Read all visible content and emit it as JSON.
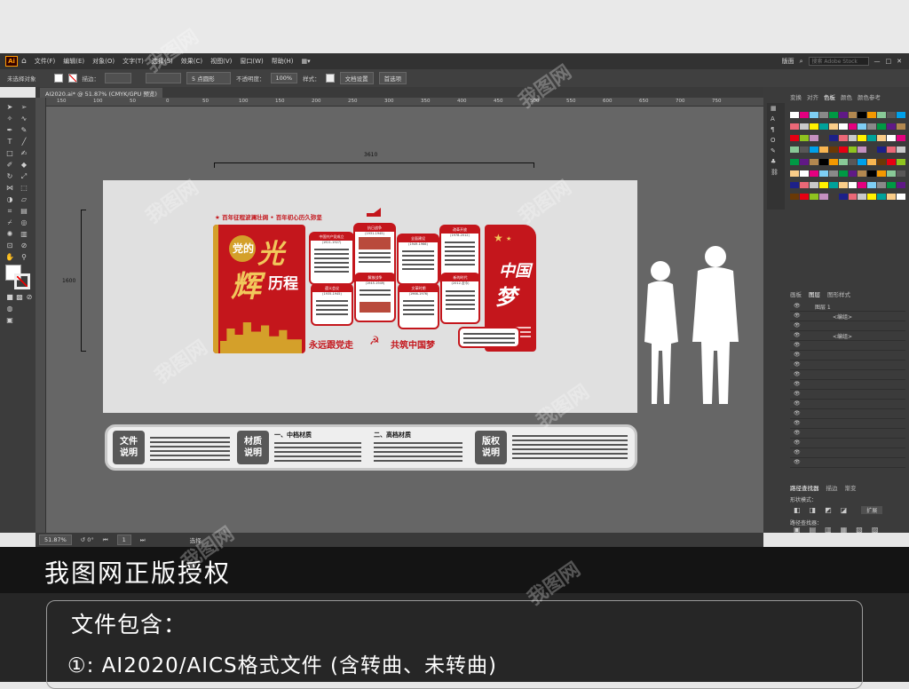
{
  "menu": {
    "app_icon": "Ai",
    "items": [
      "文件(F)",
      "编辑(E)",
      "对象(O)",
      "文字(T)",
      "选择(S)",
      "效果(C)",
      "视图(V)",
      "窗口(W)",
      "帮助(H)"
    ],
    "workspace": "版面",
    "search_placeholder": "搜索 Adobe Stock"
  },
  "control": {
    "selection": "未选择对象",
    "stroke_label": "描边：",
    "brush": "5 点圆形",
    "opacity_label": "不透明度：",
    "opacity": "100%",
    "style_label": "样式：",
    "doc_setup": "文档设置",
    "prefs": "首选项"
  },
  "document": {
    "tab": "AI2020.ai* @ 51.87% (CMYK/GPU 预览)"
  },
  "rulers": {
    "h_ticks": [
      "150",
      "100",
      "50",
      "0",
      "50",
      "100",
      "150",
      "200",
      "250",
      "300",
      "350",
      "400",
      "450",
      "500",
      "550",
      "600",
      "650",
      "700",
      "750"
    ],
    "width_dim": "3610",
    "height_dim": "1600"
  },
  "artboard": {
    "header": "★ 百年征程波澜壮阔 • 百年初心历久弥坚",
    "left_title": [
      "党的",
      "光",
      "辉",
      "历程"
    ],
    "cards": [
      {
        "head": "中国共产党成立",
        "sub": "(1921-1927)"
      },
      {
        "head": "抗日战争",
        "sub": "(1931-1945)"
      },
      {
        "head": "全面建设",
        "sub": "(1949-1966)"
      },
      {
        "head": "改革开放",
        "sub": "(1978-2012)"
      },
      {
        "head": "遵义会议",
        "sub": "(1935-1945)"
      },
      {
        "head": "解放战争",
        "sub": "(1945-1949)"
      },
      {
        "head": "文革时期",
        "sub": "(1966-1976)"
      },
      {
        "head": "新的时代",
        "sub": "(2012-至今)"
      }
    ],
    "slogan_left": "永远跟党走",
    "slogan_right": "共筑中国梦",
    "right_title": [
      "中国",
      "梦"
    ]
  },
  "legend": {
    "tag1": [
      "文件",
      "说明"
    ],
    "tag2": [
      "材质",
      "说明"
    ],
    "mat1": "一、中档材质",
    "mat2": "二、高档材质",
    "tag3": [
      "版权",
      "说明"
    ]
  },
  "panel": {
    "tabs": [
      "变换",
      "对齐",
      "色板",
      "颜色",
      "颜色参考"
    ],
    "layer_tabs": [
      "图层",
      "画板",
      "图形样式"
    ],
    "layers": [
      "图层 1",
      "<编组>",
      "<编组>"
    ],
    "pathfinder_tabs": [
      "路径查找器",
      "描边",
      "渐变"
    ],
    "shape_modes": "形状模式：",
    "expand": "扩展",
    "pathfinder": "路径查找器："
  },
  "status": {
    "zoom": "51.87%",
    "page": "1",
    "mode": "选择"
  },
  "banner": {
    "title": "我图网正版授权"
  },
  "info": {
    "contains": "文件包含：",
    "item1": "①: AI2020/AICS格式文件 (含转曲、未转曲)"
  },
  "watermark": "我图网",
  "colors": {
    "red": "#c4161c",
    "gold": "#d4a02a",
    "canvas": "#666666",
    "ui_dark": "#3b3b3b"
  }
}
